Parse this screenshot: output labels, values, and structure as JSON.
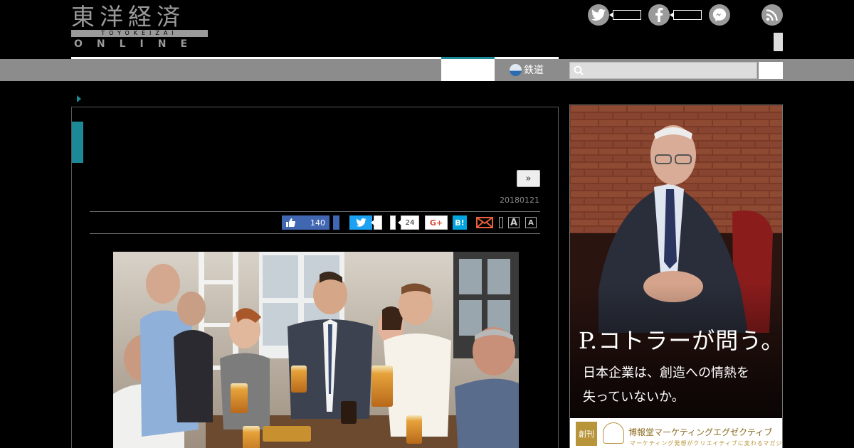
{
  "header": {
    "logo": {
      "jp": "東洋経済",
      "romaji": "TOYOKEIZAI",
      "online": "ONLINE"
    },
    "social": [
      "twitter-icon",
      "facebook-icon",
      "messenger-icon",
      "rss-icon"
    ]
  },
  "nav": {
    "rail_label": "鉄道",
    "search_placeholder": ""
  },
  "article": {
    "date": "20180121",
    "next_label": "»",
    "share": {
      "facebook_count": "140",
      "pocket_count": "24",
      "gplus_label": "G+",
      "hatena_label": "B!",
      "font_large": "A",
      "font_small": "A"
    }
  },
  "ad": {
    "headline": "P.コトラーが問う。",
    "sub1": "日本企業は、創造への情熱を",
    "sub2": "失っていないか。",
    "tag": "創刊",
    "brand": "博報堂マーケティングエグゼクティブ",
    "brand_sub": "マーケティング発想がクリエイティブに変わるマガジン"
  },
  "colors": {
    "accent": "#1c8a96",
    "nav_bg": "#8c8c8c",
    "facebook": "#4267b2",
    "twitter": "#1da1f2",
    "hatena": "#00a4de"
  }
}
